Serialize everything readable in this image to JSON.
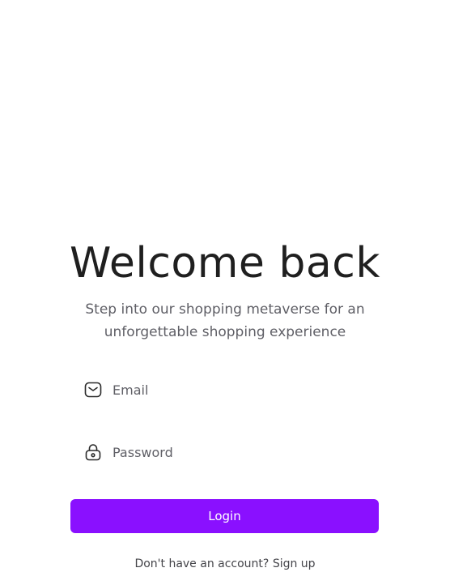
{
  "heading": {
    "title": "Welcome back",
    "subtitle": "Step into our shopping metaverse for an unforgettable shopping experience"
  },
  "form": {
    "email": {
      "placeholder": "Email",
      "value": "",
      "icon": "mail-icon"
    },
    "password": {
      "placeholder": "Password",
      "value": "",
      "icon": "lock-icon"
    },
    "login_label": "Login"
  },
  "footer": {
    "prompt": "Don't have an account?",
    "signup_link": "Sign up"
  },
  "colors": {
    "accent": "#8a10ff",
    "text": "#1f1f1f",
    "muted": "#5f5f66"
  }
}
